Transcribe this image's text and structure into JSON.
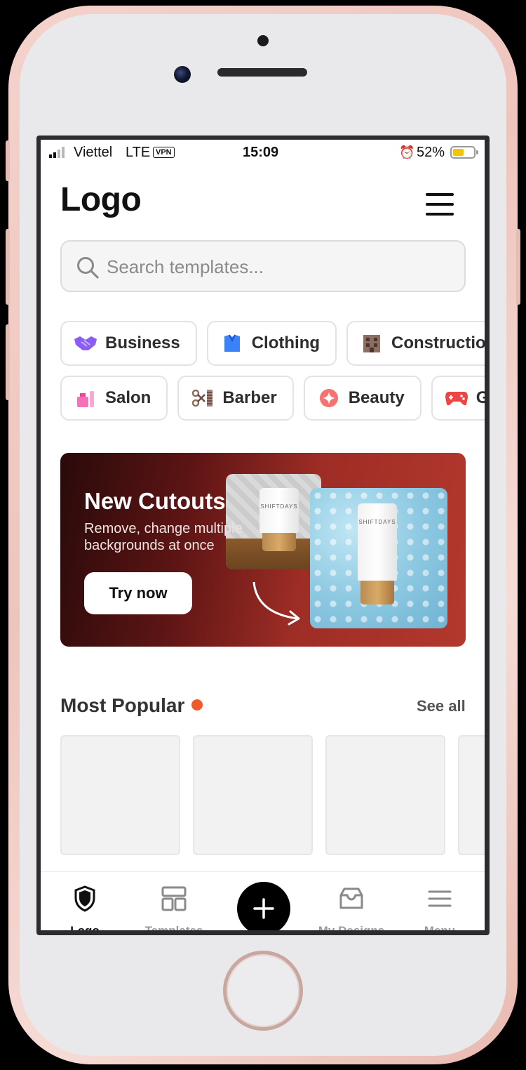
{
  "status_bar": {
    "carrier": "Viettel",
    "network": "LTE",
    "vpn": "VPN",
    "time": "15:09",
    "battery": "52%",
    "battery_level": 0.52
  },
  "header": {
    "logo": "Logo"
  },
  "search": {
    "placeholder": "Search templates..."
  },
  "categories_row1": [
    {
      "label": "Business",
      "icon": "handshake-icon"
    },
    {
      "label": "Clothing",
      "icon": "shirt-icon"
    },
    {
      "label": "Construction",
      "icon": "building-icon"
    }
  ],
  "categories_row2": [
    {
      "label": "Salon",
      "icon": "lipstick-icon"
    },
    {
      "label": "Barber",
      "icon": "scissors-icon"
    },
    {
      "label": "Beauty",
      "icon": "sparkle-icon"
    },
    {
      "label": "Gaming",
      "icon": "gamepad-icon"
    }
  ],
  "banner": {
    "title": "New Cutouts",
    "subtitle": "Remove, change multiple backgrounds at once",
    "cta": "Try now",
    "product_brand": "SHIFTDAYS"
  },
  "popular": {
    "title": "Most Popular",
    "see_all": "See all"
  },
  "bottom_nav": {
    "items": [
      {
        "label": "Logo",
        "icon": "shield-icon",
        "active": true
      },
      {
        "label": "Templates",
        "icon": "templates-icon",
        "active": false
      },
      {
        "label": "My Designs",
        "icon": "folder-icon",
        "active": false
      },
      {
        "label": "Menu",
        "icon": "menu-icon",
        "active": false
      }
    ],
    "create_icon": "plus-icon"
  },
  "colors": {
    "accent_dot": "#f05a28",
    "banner_red": "#b3382d",
    "battery_yellow": "#f5c400"
  }
}
